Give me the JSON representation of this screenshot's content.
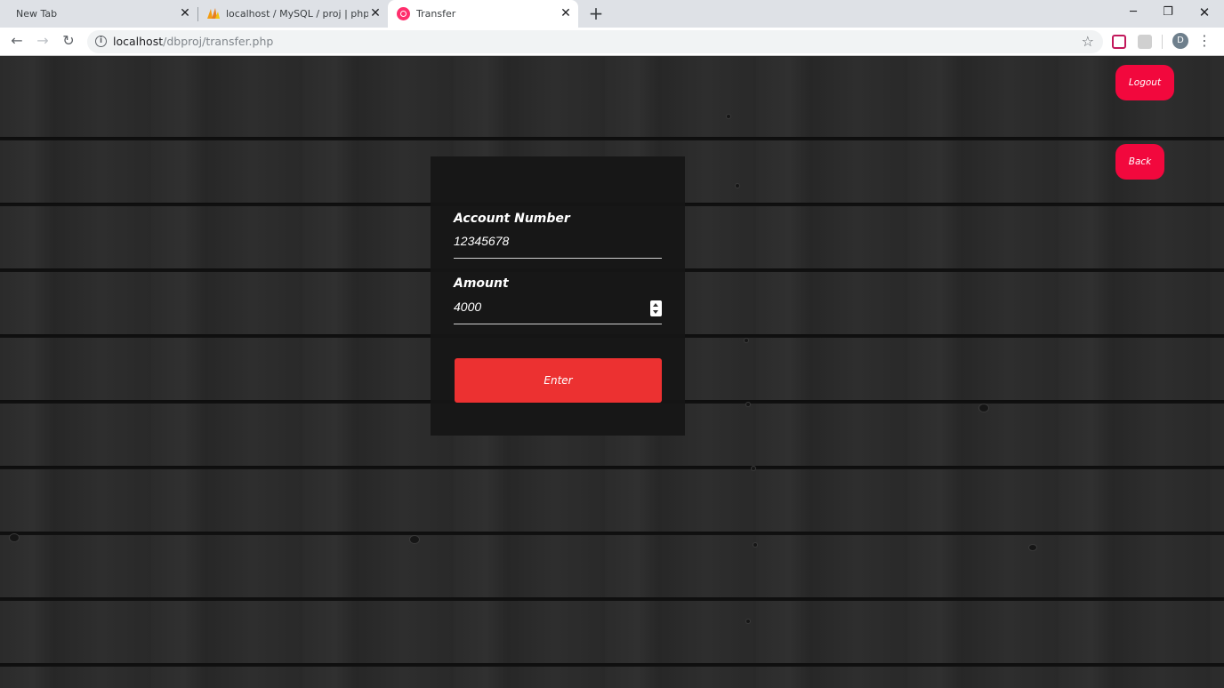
{
  "browser": {
    "tabs": [
      {
        "title": "New Tab"
      },
      {
        "title": "localhost / MySQL / proj | phpMy"
      },
      {
        "title": "Transfer"
      }
    ],
    "url_host": "localhost",
    "url_path": "/dbproj/transfer.php",
    "profile_initial": "D"
  },
  "page": {
    "logout_label": "Logout",
    "back_label": "Back",
    "form": {
      "account_label": "Account Number",
      "account_value": "12345678",
      "amount_label": "Amount",
      "amount_value": "4000",
      "submit_label": "Enter"
    }
  },
  "colors": {
    "accent_pink": "#f2083d",
    "submit_red": "#ec3131",
    "panel_bg": "#161616"
  }
}
